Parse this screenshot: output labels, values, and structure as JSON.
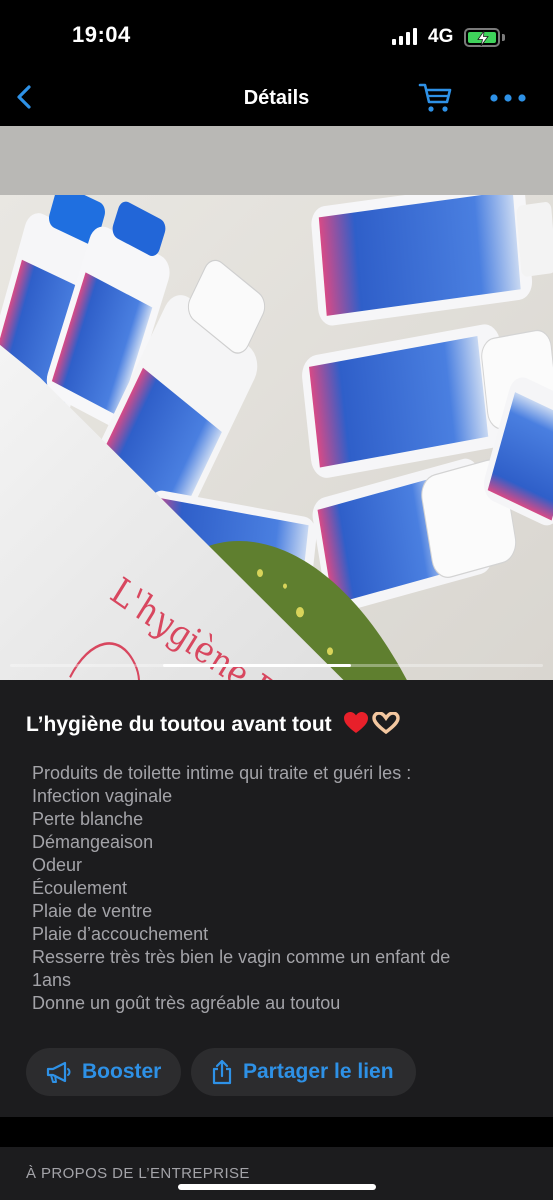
{
  "status": {
    "time": "19:04",
    "network": "4G",
    "battery_charging": true,
    "battery_color": "#3fd25b"
  },
  "nav": {
    "title": "Détails",
    "back_icon": "chevron-left-icon",
    "cart_icon": "cart-icon",
    "more_icon": "more-dots-icon",
    "accent_color": "#2e91e6"
  },
  "carousel": {
    "page_count_shown": 3,
    "active_page": 2
  },
  "product": {
    "title": "L’hygiène du toutou avant tout",
    "title_emojis": [
      "red-heart-emoji",
      "heart-hands-emoji"
    ],
    "description_lines": [
      "Produits de toilette intime qui traite et guéri les :",
      "Infection vaginale",
      "Perte blanche",
      "Démangeaison",
      "Odeur",
      "Écoulement",
      "Plaie de ventre",
      "Plaie d’accouchement",
      "Resserre très très bien le vagin comme un enfant de",
      "1ans",
      "Donne un goût très agréable au toutou"
    ]
  },
  "actions": {
    "booster_label": "Booster",
    "share_label": "Partager le lien"
  },
  "section": {
    "about_title": "À PROPOS DE L’ENTREPRISE"
  }
}
